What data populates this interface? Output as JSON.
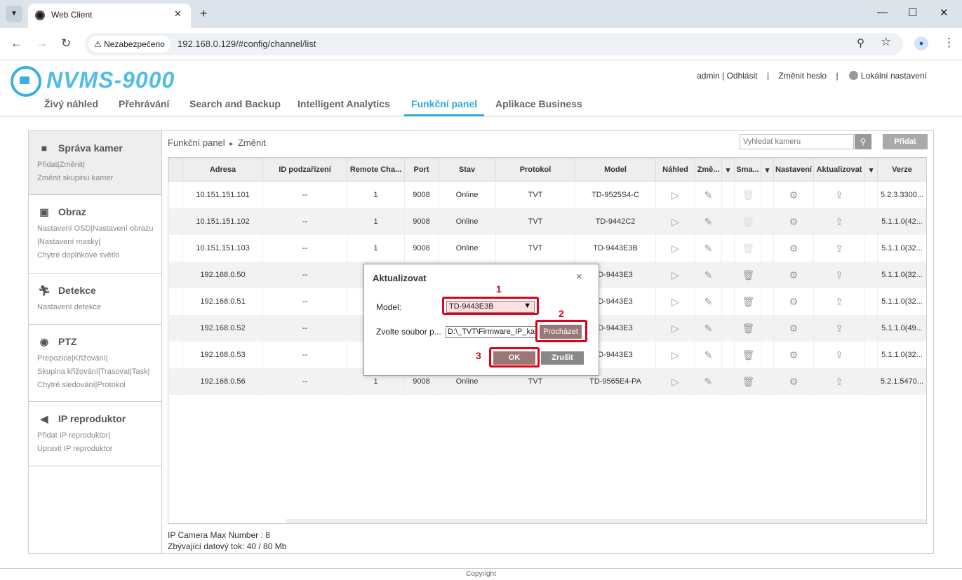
{
  "browser": {
    "tab_title": "Web Client",
    "security_label": "Nezabezpečeno",
    "url": "192.168.0.129/#config/channel/list"
  },
  "header": {
    "logo": "NVMS-9000",
    "user_link": "admin | Odhlásit",
    "separator": "|",
    "change_password": "Změnit heslo",
    "local_settings": "Lokální nastavení"
  },
  "nav": [
    {
      "label": "Živý náhled",
      "active": false
    },
    {
      "label": "Přehrávání",
      "active": false
    },
    {
      "label": "Search and Backup",
      "active": false
    },
    {
      "label": "Intelligent Analytics",
      "active": false
    },
    {
      "label": "Funkční panel",
      "active": true
    },
    {
      "label": "Aplikace Business",
      "active": false
    }
  ],
  "sidebar": [
    {
      "title": "Správa kamer",
      "icon": "camera-icon",
      "subs": [
        "Přidat|Změnit|",
        "Změnit skupinu kamer"
      ]
    },
    {
      "title": "Obraz",
      "icon": "image-icon",
      "subs": [
        "Nastavení OSD|Nastavení obrazu",
        "|Nastavení masky|",
        "Chytré doplňkové světlo"
      ]
    },
    {
      "title": "Detekce",
      "icon": "running-person-icon",
      "subs": [
        "Nastavení detekce"
      ]
    },
    {
      "title": "PTZ",
      "icon": "ptz-camera-icon",
      "subs": [
        "Prepozice|Křižování|",
        "Skupina křižování|Trasovat|Task|",
        "Chytré sledování|Protokol"
      ]
    },
    {
      "title": "IP reproduktor",
      "icon": "speaker-icon",
      "subs": [
        "Přidat IP reproduktor|",
        "Upravit IP reproduktor"
      ]
    }
  ],
  "content": {
    "breadcrumb_root": "Funkční panel",
    "breadcrumb_sep": "▸",
    "breadcrumb_leaf": "Změnit",
    "search_placeholder": "Vyhledat kameru",
    "add_button": "Přidat",
    "footer_max": "IP Camera Max Number : 8",
    "footer_bandwidth": "Zbývající datový tok: 40 / 80 Mb"
  },
  "table": {
    "headers": [
      "",
      "Adresa",
      "ID podzařízení",
      "Remote Cha...",
      "Port",
      "Stav",
      "Protokol",
      "Model",
      "Náhled",
      "Změ...",
      "",
      "Sma...",
      "",
      "Nastavení",
      "Aktualizovat",
      "",
      "Verze"
    ],
    "rows": [
      {
        "address": "10.151.151.101",
        "subid": "--",
        "remote": "1",
        "port": "9008",
        "status": "Online",
        "protocol": "TVT",
        "model": "TD-9525S4-C",
        "version": "5.2.3.3300...",
        "delete_disabled": true
      },
      {
        "address": "10.151.151.102",
        "subid": "--",
        "remote": "1",
        "port": "9008",
        "status": "Online",
        "protocol": "TVT",
        "model": "TD-9442C2",
        "version": "5.1.1.0(42...",
        "delete_disabled": true
      },
      {
        "address": "10.151.151.103",
        "subid": "--",
        "remote": "1",
        "port": "9008",
        "status": "Online",
        "protocol": "TVT",
        "model": "TD-9443E3B",
        "version": "5.1.1.0(32...",
        "delete_disabled": true
      },
      {
        "address": "192.168.0.50",
        "subid": "--",
        "remote": "",
        "port": "",
        "status": "",
        "protocol": "",
        "model": "D-9443E3",
        "version": "5.1.1.0(32...",
        "delete_disabled": false
      },
      {
        "address": "192.168.0.51",
        "subid": "--",
        "remote": "",
        "port": "",
        "status": "",
        "protocol": "",
        "model": "D-9443E3",
        "version": "5.1.1.0(32...",
        "delete_disabled": false
      },
      {
        "address": "192.168.0.52",
        "subid": "--",
        "remote": "",
        "port": "",
        "status": "",
        "protocol": "",
        "model": "D-9443E3",
        "version": "5.1.1.0(49...",
        "delete_disabled": false
      },
      {
        "address": "192.168.0.53",
        "subid": "--",
        "remote": "",
        "port": "",
        "status": "",
        "protocol": "",
        "model": "D-9443E3",
        "version": "5.1.1.0(32...",
        "delete_disabled": false
      },
      {
        "address": "192.168.0.56",
        "subid": "--",
        "remote": "1",
        "port": "9008",
        "status": "Online",
        "protocol": "TVT",
        "model": "TD-9565E4-PA",
        "version": "5.2.1.5470...",
        "delete_disabled": false
      }
    ]
  },
  "dialog": {
    "title": "Aktualizovat",
    "close": "×",
    "model_label": "Model:",
    "model_value": "TD-9443E3B",
    "file_label": "Zvolte soubor p...",
    "file_value": "D:\\_TVT\\Firmware_IP_kam",
    "browse": "Procházet",
    "ok": "OK",
    "cancel": "Zrušit",
    "steps": [
      "1",
      "2",
      "3"
    ]
  },
  "copyright": "Copyright",
  "colors": {
    "accent": "#2ea7dc",
    "online": "#2fa23a",
    "annotation": "#e1001a",
    "dialog_button": "#9a7676"
  }
}
